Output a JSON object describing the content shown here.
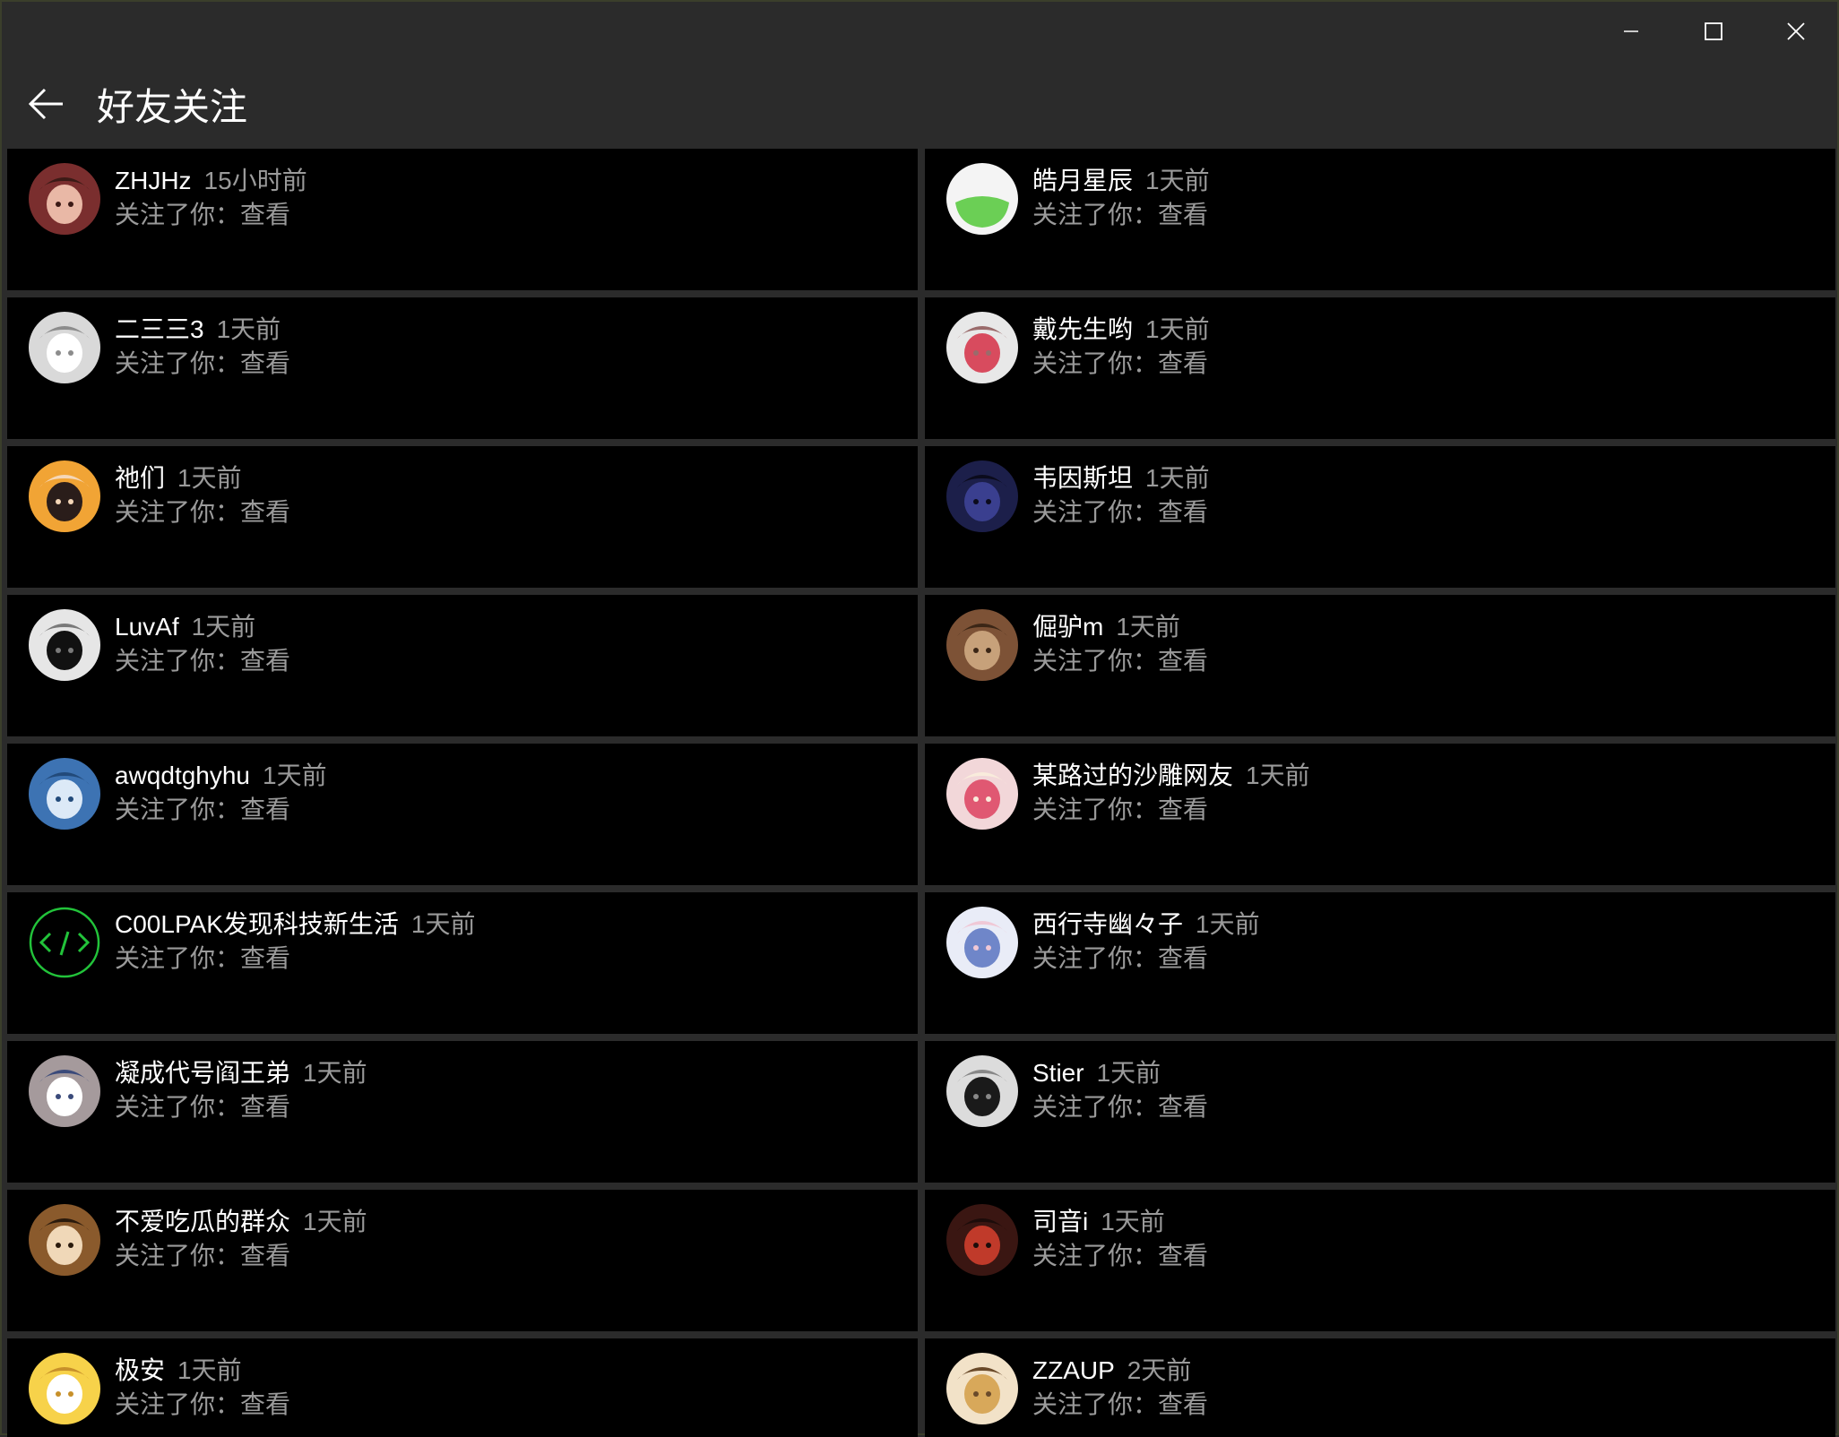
{
  "window": {
    "controls": [
      "minimize-icon",
      "maximize-icon",
      "close-icon"
    ]
  },
  "header": {
    "title": "好友关注",
    "back_icon": "back-arrow-icon"
  },
  "colors": {
    "background": "#2b2b2b",
    "card": "#000000",
    "name_text": "#ffffff",
    "meta_text": "#9a9a9a"
  },
  "follow_prefix": "关注了你：",
  "view_label": "查看",
  "items": [
    {
      "name": "ZHJHz",
      "time": "15小时前",
      "avatar": "anime-girl-red-hat-avatar"
    },
    {
      "name": "皓月星辰",
      "time": "1天前",
      "avatar": "green-flask-avatar"
    },
    {
      "name": "二三三3",
      "time": "1天前",
      "avatar": "white-hair-anime-avatar"
    },
    {
      "name": "戴先生哟",
      "time": "1天前",
      "avatar": "rose-hand-avatar"
    },
    {
      "name": "祂们",
      "time": "1天前",
      "avatar": "anime-girl-dark-hair-avatar"
    },
    {
      "name": "韦因斯坦",
      "time": "1天前",
      "avatar": "dark-blue-anime-avatar"
    },
    {
      "name": "LuvAf",
      "time": "1天前",
      "avatar": "sketch-anime-avatar"
    },
    {
      "name": "倔驴m",
      "time": "1天前",
      "avatar": "cartoon-cat-avatar"
    },
    {
      "name": "awqdtghyhu",
      "time": "1天前",
      "avatar": "dandelion-sky-avatar"
    },
    {
      "name": "某路过的沙雕网友",
      "time": "1天前",
      "avatar": "anime-girl-bow-avatar"
    },
    {
      "name": "C00LPAK发现科技新生活",
      "time": "1天前",
      "avatar": "code-brackets-avatar"
    },
    {
      "name": "西行寺幽々子",
      "time": "1天前",
      "avatar": "anime-ghost-princess-avatar"
    },
    {
      "name": "凝成代号阎王弟",
      "time": "1天前",
      "avatar": "anime-girl-maid-avatar"
    },
    {
      "name": "Stier",
      "time": "1天前",
      "avatar": "monochrome-anime-avatar"
    },
    {
      "name": "不爱吃瓜的群众",
      "time": "1天前",
      "avatar": "puppy-photo-avatar"
    },
    {
      "name": "司音i",
      "time": "1天前",
      "avatar": "anime-red-hat-avatar"
    },
    {
      "name": "极安",
      "time": "1天前",
      "avatar": "yellow-cat-meme-avatar"
    },
    {
      "name": "ZZAUP",
      "time": "2天前",
      "avatar": "blonde-anime-avatar"
    }
  ]
}
